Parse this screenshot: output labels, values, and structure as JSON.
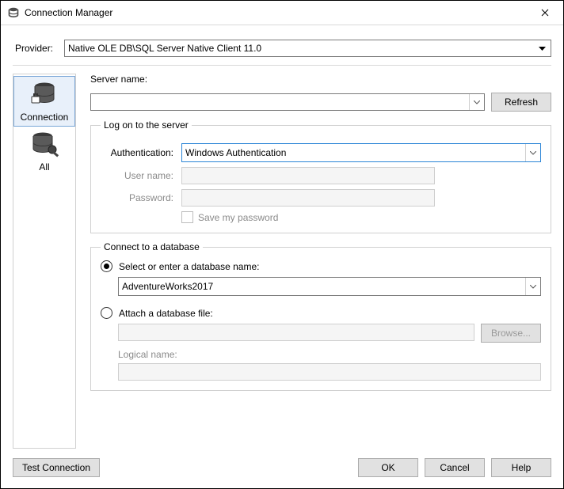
{
  "window": {
    "title": "Connection Manager"
  },
  "provider": {
    "label": "Provider:",
    "value": "Native OLE DB\\SQL Server Native Client 11.0"
  },
  "sidebar": {
    "items": [
      {
        "label": "Connection"
      },
      {
        "label": "All"
      }
    ]
  },
  "server": {
    "label": "Server name:",
    "refresh": "Refresh"
  },
  "logon": {
    "legend": "Log on to the server",
    "authLabel": "Authentication:",
    "authValue": "Windows Authentication",
    "userLabel": "User name:",
    "passLabel": "Password:",
    "savePass": "Save my password"
  },
  "db": {
    "legend": "Connect to a database",
    "selectRadio": "Select or enter a database name:",
    "selectedDb": "AdventureWorks2017",
    "attachRadio": "Attach a database file:",
    "browse": "Browse...",
    "logicalLabel": "Logical name:"
  },
  "footer": {
    "test": "Test Connection",
    "ok": "OK",
    "cancel": "Cancel",
    "help": "Help"
  }
}
